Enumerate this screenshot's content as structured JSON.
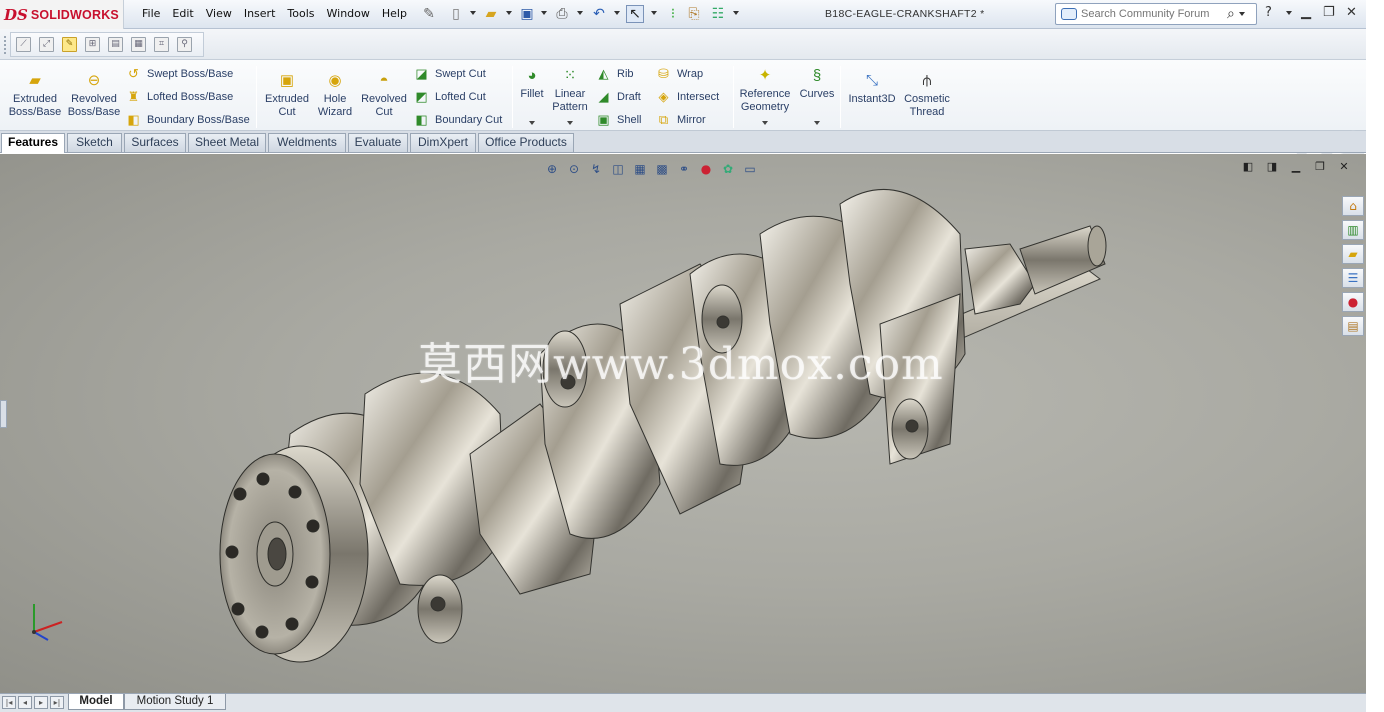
{
  "app": {
    "logo_ds": "DS",
    "logo_text": "SOLIDWORKS",
    "document_title": "B18C-EAGLE-CRANKSHAFT2 *"
  },
  "menus": [
    "File",
    "Edit",
    "View",
    "Insert",
    "Tools",
    "Window",
    "Help"
  ],
  "search": {
    "placeholder": "Search Community Forum"
  },
  "command_manager": {
    "extruded_boss": "Extruded Boss/Base",
    "revolved_boss": "Revolved Boss/Base",
    "swept_boss": "Swept Boss/Base",
    "lofted_boss": "Lofted Boss/Base",
    "boundary_boss": "Boundary Boss/Base",
    "extruded_cut": "Extruded Cut",
    "hole_wizard": "Hole Wizard",
    "revolved_cut": "Revolved Cut",
    "swept_cut": "Swept Cut",
    "lofted_cut": "Lofted Cut",
    "boundary_cut": "Boundary Cut",
    "fillet": "Fillet",
    "linear_pattern": "Linear Pattern",
    "rib": "Rib",
    "draft": "Draft",
    "shell": "Shell",
    "wrap": "Wrap",
    "intersect": "Intersect",
    "mirror": "Mirror",
    "reference_geometry": "Reference Geometry",
    "curves": "Curves",
    "instant3d": "Instant3D",
    "cosmetic_thread": "Cosmetic Thread"
  },
  "tabs": [
    "Features",
    "Sketch",
    "Surfaces",
    "Sheet Metal",
    "Weldments",
    "Evaluate",
    "DimXpert",
    "Office Products"
  ],
  "active_tab": "Features",
  "viewport": {
    "watermark": "莫西网www.3dmox.com",
    "model_name": "crankshaft"
  },
  "bottom_tabs": [
    "Model",
    "Motion Study 1"
  ],
  "active_bottom_tab": "Model",
  "colors": {
    "brand_red": "#c8102e",
    "viewport_bg": "#a9a9a2",
    "label_blue": "#2a3f66"
  },
  "icons": {
    "new": "new-document-icon",
    "open": "open-folder-icon",
    "save": "save-icon",
    "print": "print-icon",
    "undo": "undo-icon",
    "select": "select-arrow-icon",
    "rebuild": "traffic-light-icon",
    "options": "options-icon",
    "help": "help-icon"
  }
}
